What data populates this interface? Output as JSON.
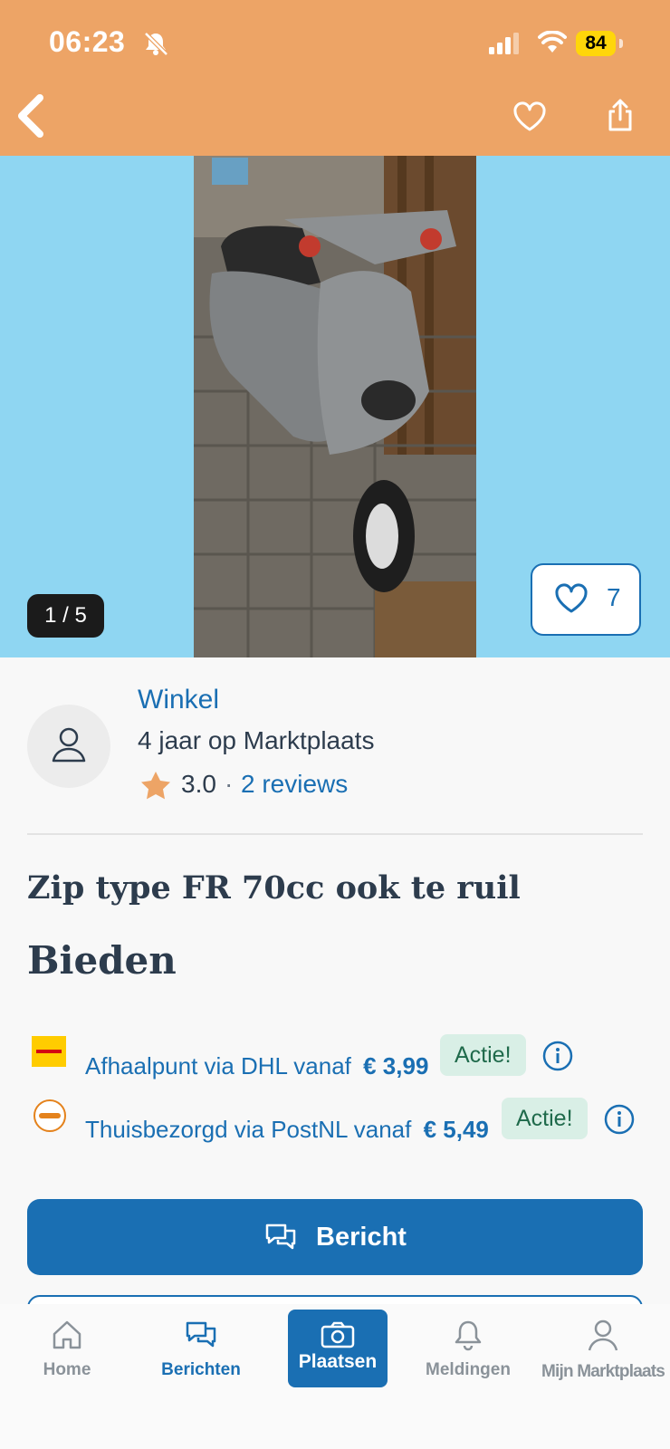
{
  "status_bar": {
    "time": "06:23",
    "battery": "84"
  },
  "gallery": {
    "counter": "1 / 5",
    "likes": "7"
  },
  "seller": {
    "name": "Winkel",
    "since": "4 jaar op Marktplaats",
    "rating": "3.0",
    "separator": "·",
    "reviews": "2 reviews"
  },
  "listing": {
    "title": "Zip type FR 70cc ook te ruil",
    "price": "Bieden"
  },
  "shipping": [
    {
      "label": "Afhaalpunt via DHL vanaf",
      "price": "€ 3,99",
      "badge": "Actie!",
      "logo": "dhl-logo"
    },
    {
      "label": "Thuisbezorgd via PostNL vanaf",
      "price": "€ 5,49",
      "badge": "Actie!",
      "logo": "postnl-logo"
    }
  ],
  "actions": {
    "message_button": "Bericht"
  },
  "nav": {
    "home": "Home",
    "messages": "Berichten",
    "place": "Plaatsen",
    "notifications": "Meldingen",
    "my": "Mijn Marktplaats"
  },
  "colors": {
    "header": "#eda466",
    "brand": "#1a6fb3",
    "gallery_bg": "#8fd6f2",
    "badge_bg": "#d9efe6"
  }
}
